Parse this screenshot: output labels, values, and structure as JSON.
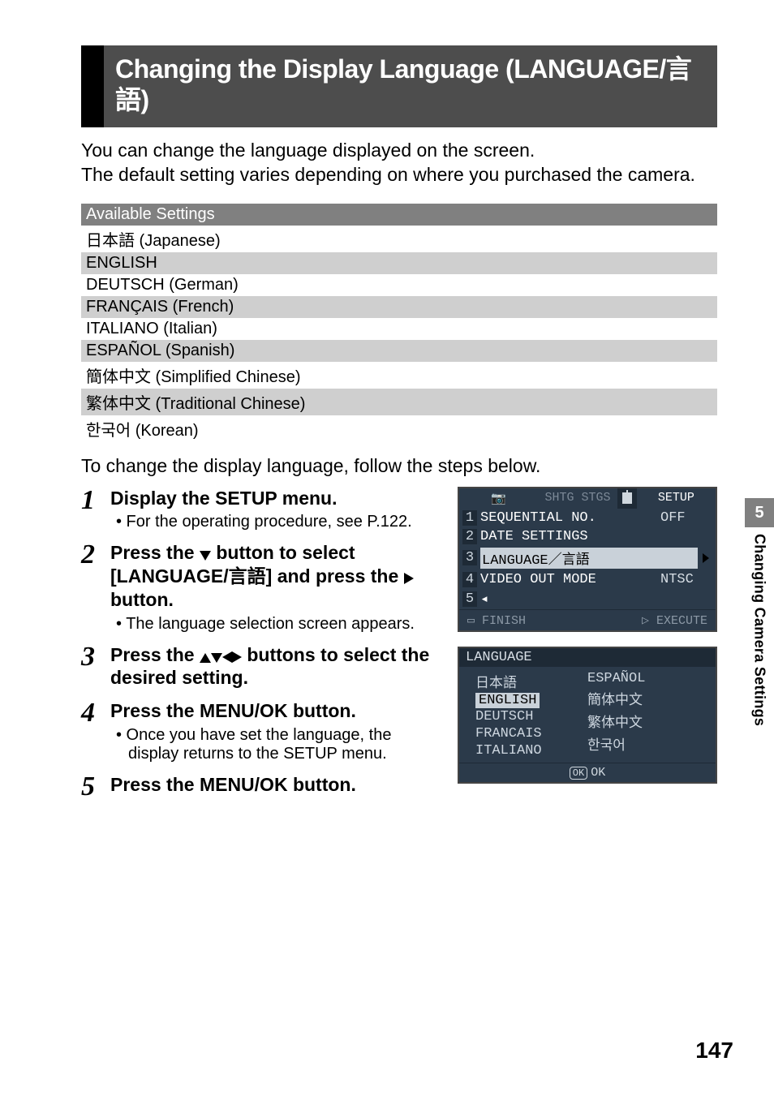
{
  "section_title": "Changing the Display Language (LANGUAGE/言語)",
  "intro_line1": "You can change the language displayed on the screen.",
  "intro_line2": "The default setting varies depending on where you purchased the camera.",
  "settings_header": "Available Settings",
  "settings_rows": [
    "日本語 (Japanese)",
    "ENGLISH",
    "DEUTSCH (German)",
    "FRANÇAIS (French)",
    "ITALIANO (Italian)",
    "ESPAÑOL (Spanish)",
    "簡体中文 (Simplified Chinese)",
    "繁体中文 (Traditional Chinese)",
    "한국어 (Korean)"
  ],
  "steps_lead": "To change the display language, follow the steps below.",
  "steps": {
    "1": {
      "num": "1",
      "title": "Display the SETUP menu.",
      "sub": "• For the operating procedure, see P.122."
    },
    "2": {
      "num": "2",
      "title_pre": "Press the ",
      "title_mid": " button to select [LANGUAGE/言語] and press the ",
      "title_post": " button.",
      "sub": "• The language selection screen appears."
    },
    "3": {
      "num": "3",
      "title_pre": "Press the ",
      "title_post": " buttons to select the desired setting."
    },
    "4": {
      "num": "4",
      "title": "Press the MENU/OK button.",
      "sub": "• Once you have set the language, the display returns to the SETUP menu."
    },
    "5": {
      "num": "5",
      "title": "Press the MENU/OK button."
    }
  },
  "lcd1": {
    "tabs": {
      "left": "SHTG STGS",
      "right": "SETUP"
    },
    "rows": {
      "1": {
        "idx": "1",
        "label": "SEQUENTIAL NO.",
        "val": "OFF"
      },
      "2": {
        "idx": "2",
        "label": "DATE SETTINGS",
        "val": ""
      },
      "3": {
        "idx": "3",
        "label": "LANGUAGE／言語",
        "val": ""
      },
      "4": {
        "idx": "4",
        "label": "VIDEO OUT MODE",
        "val": "NTSC"
      },
      "5": {
        "idx": "5",
        "label": "",
        "val": ""
      }
    },
    "footer_left": "FINISH",
    "footer_right": "EXECUTE"
  },
  "lcd2": {
    "header": "LANGUAGE",
    "col1": [
      "日本語",
      "ENGLISH",
      "DEUTSCH",
      "FRANCAIS",
      "ITALIANO"
    ],
    "col2": [
      "ESPAÑOL",
      "簡体中文",
      "繁体中文",
      "한국어",
      ""
    ],
    "sel": "ENGLISH",
    "foot": "OK"
  },
  "side": {
    "chapter": "5",
    "label": "Changing Camera Settings"
  },
  "page_number": "147"
}
